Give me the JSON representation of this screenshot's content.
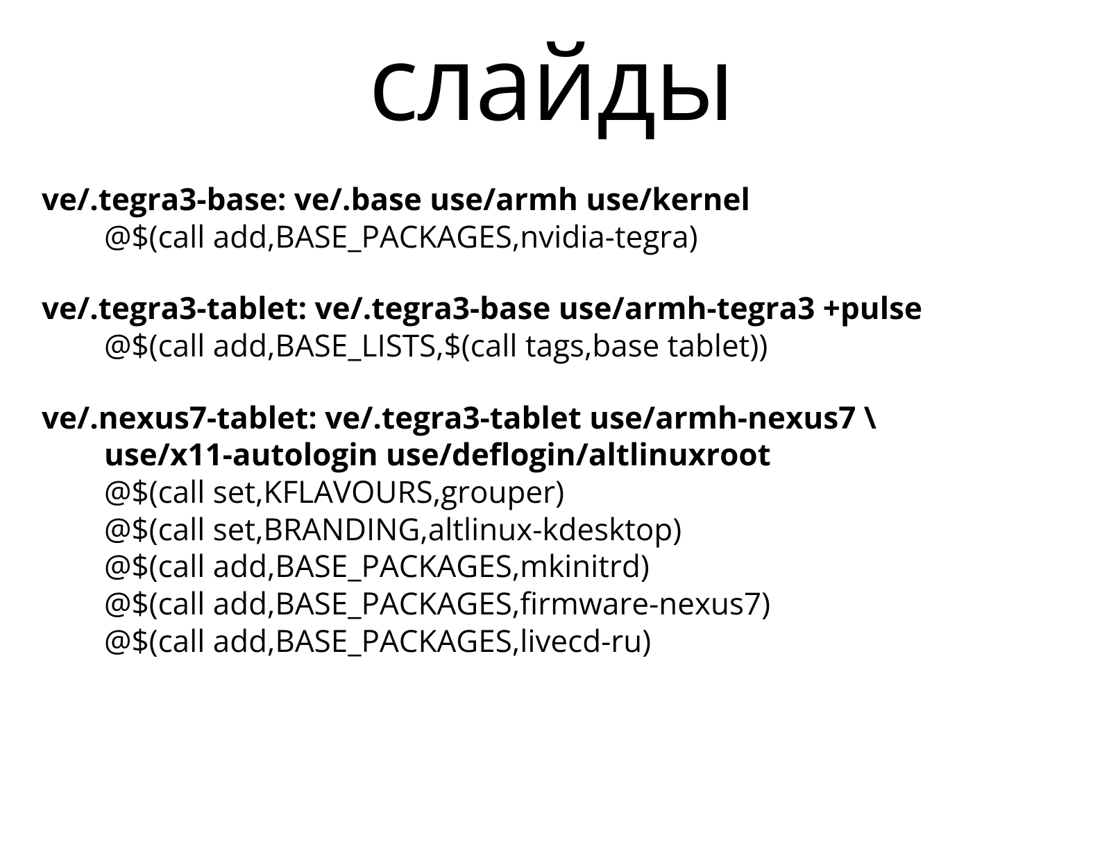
{
  "title": "слайды",
  "blocks": [
    {
      "rule": "ve/.tegra3-base: ve/.base use/armh use/kernel",
      "cont": [],
      "cmds": [
        "@$(call add,BASE_PACKAGES,nvidia-tegra)"
      ]
    },
    {
      "rule": "ve/.tegra3-tablet: ve/.tegra3-base use/armh-tegra3 +pulse",
      "cont": [],
      "cmds": [
        "@$(call add,BASE_LISTS,$(call tags,base tablet))"
      ]
    },
    {
      "rule": "ve/.nexus7-tablet: ve/.tegra3-tablet use/armh-nexus7 \\",
      "cont": [
        "use/x11-autologin use/deflogin/altlinuxroot"
      ],
      "cmds": [
        "@$(call set,KFLAVOURS,grouper)",
        "@$(call set,BRANDING,altlinux-kdesktop)",
        "@$(call add,BASE_PACKAGES,mkinitrd)",
        "@$(call add,BASE_PACKAGES,firmware-nexus7)",
        "@$(call add,BASE_PACKAGES,livecd-ru)"
      ]
    }
  ]
}
